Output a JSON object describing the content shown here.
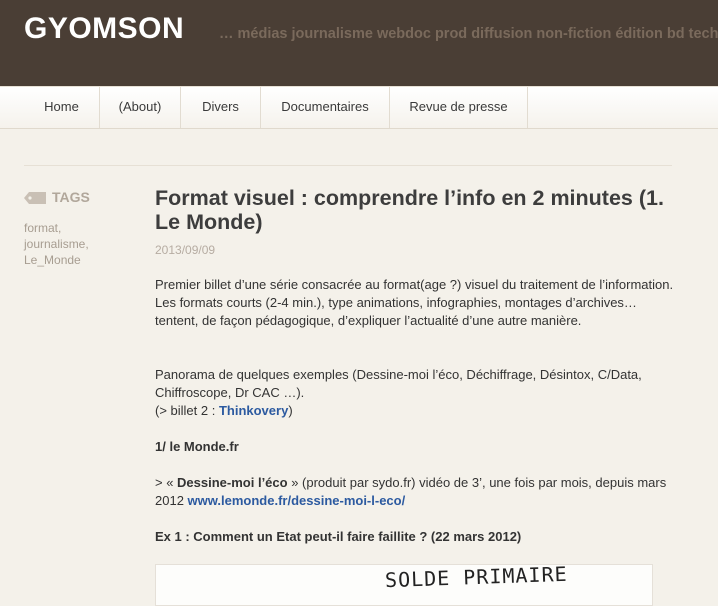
{
  "header": {
    "site_title": "GYOMSON",
    "tagline": "… médias journalisme webdoc prod diffusion non-fiction édition bd tech"
  },
  "nav": {
    "items": [
      "Home",
      "(About)",
      "Divers",
      "Documentaires",
      "Revue de presse"
    ]
  },
  "sidebar": {
    "tags_heading": "TAGS",
    "tags": [
      "format,",
      "journalisme,",
      "Le_Monde"
    ]
  },
  "post": {
    "title": "Format visuel : comprendre l’info en 2 minutes (1. Le Monde)",
    "date": "2013/09/09",
    "p1": "Premier billet d’une série consacrée au format(age ?) visuel du traitement de l’information. Les formats courts (2-4 min.), type animations, infographies, montages d’archives… tentent, de façon pédagogique, d’expliquer l’actualité d’une autre manière.",
    "p2_line1": "Panorama de quelques exemples (Dessine-moi l’éco,  Déchiffrage, Désintox, C/Data, Chiffroscope, Dr CAC …).",
    "p2_line2_prefix": "(> billet 2 : ",
    "p2_line2_link": "Thinkovery",
    "p2_line2_suffix": ")",
    "section_heading": "1/ le Monde.fr",
    "p3_prefix": "> « ",
    "p3_bold": "Dessine-moi l’éco",
    "p3_middle": " » (produit par sydo.fr) vidéo de 3’, une fois par mois, depuis mars 2012 ",
    "p3_link": "www.lemonde.fr/dessine-moi-l-eco/",
    "example_heading": "Ex 1 : Comment un Etat peut-il faire faillite ? (22 mars 2012)",
    "image_text": "SOLDE PRIMAIRE"
  }
}
